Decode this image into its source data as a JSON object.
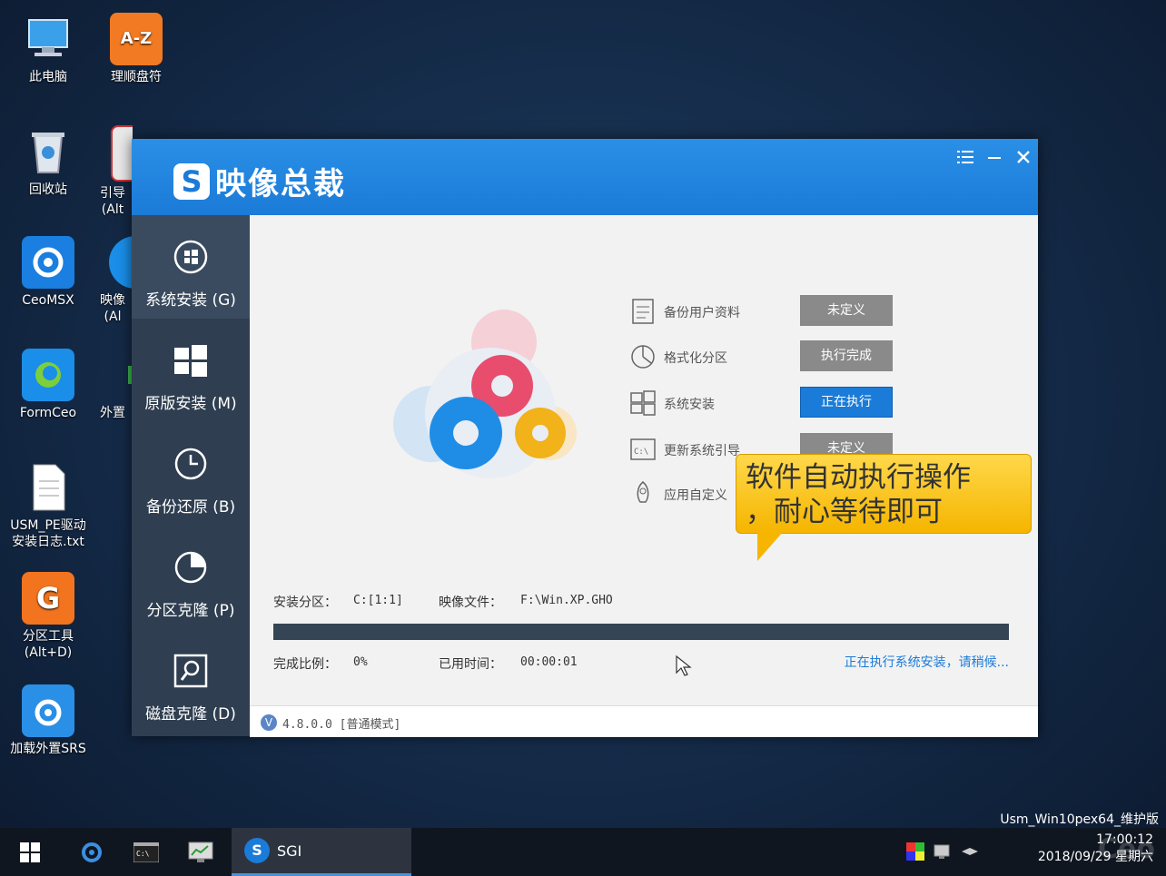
{
  "desktop": {
    "icons": [
      {
        "name": "this-pc",
        "label": "此电脑"
      },
      {
        "name": "drive-letter-tool",
        "label": "理顺盘符"
      },
      {
        "name": "recycle-bin",
        "label": "回收站"
      },
      {
        "name": "boot-repair",
        "label": "引导\n(Alt"
      },
      {
        "name": "ceomsx",
        "label": "CeoMSX"
      },
      {
        "name": "image-master-desk",
        "label": "映像\n(Al"
      },
      {
        "name": "formceo",
        "label": "FormCeo"
      },
      {
        "name": "external",
        "label": "外置"
      },
      {
        "name": "usm-log",
        "label": "USM_PE驱动\n安装日志.txt"
      },
      {
        "name": "partition-tool",
        "label": "分区工具\n(Alt+D)"
      },
      {
        "name": "load-srs",
        "label": "加载外置SRS"
      }
    ]
  },
  "app": {
    "title": "映像总裁",
    "logo_letter": "S",
    "sidebar": [
      {
        "label": "系统安装 (G)"
      },
      {
        "label": "原版安装 (M)"
      },
      {
        "label": "备份还原 (B)"
      },
      {
        "label": "分区克隆 (P)"
      },
      {
        "label": "磁盘克隆 (D)"
      }
    ],
    "steps": [
      {
        "label": "备份用户资料",
        "status": "未定义"
      },
      {
        "label": "格式化分区",
        "status": "执行完成"
      },
      {
        "label": "系统安装",
        "status": "正在执行"
      },
      {
        "label": "更新系统引导",
        "status": "未定义"
      },
      {
        "label": "应用自定义",
        "status": ""
      }
    ],
    "install_partition_label": "安装分区：",
    "install_partition_value": "C:[1:1]",
    "image_file_label": "映像文件：",
    "image_file_value": "F:\\Win.XP.GHO",
    "ratio_label": "完成比例：",
    "ratio_value": "0%",
    "elapsed_label": "已用时间：",
    "elapsed_value": "00:00:01",
    "progress_fraction": 0,
    "status_text": "正在执行系统安装，请稍候...",
    "version_badge": "V",
    "version_text": "4.8.0.0 [普通模式]",
    "callout_line1": "软件自动执行操作",
    "callout_line2": "，耐心等待即可"
  },
  "taskbar": {
    "active_app": "SGI",
    "os_label": "Usm_Win10pex64_维护版",
    "time": "17:00:12",
    "date": "2018/09/29 星期六",
    "watermark": "Ceo"
  },
  "colors": {
    "accent": "#1b7bd8",
    "sidebar": "#2f3e50"
  }
}
